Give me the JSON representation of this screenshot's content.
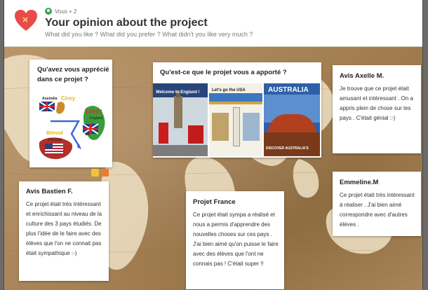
{
  "header": {
    "author": "Vous + 2",
    "title": "Your opinion about the project",
    "subtitle": "What did you like ? What did you prefer ? What didn't you like very much ?"
  },
  "cards": {
    "c1": {
      "title": "Qu'avez vous apprécié dans ce projet ?"
    },
    "c1_img": {
      "l1": "Australia",
      "l2": "Cirey",
      "l3": "Laxou",
      "l4": "England",
      "l5": "Blénod",
      "l6": "The USA"
    },
    "c2": {
      "title": "Qu'est-ce que le projet vous a apporté ?"
    },
    "c2_img": {
      "t1": "Welcome to England !",
      "t2": "Let's go the USA",
      "t3": "AUSTRALIA",
      "t4": "DISCOVER AUSTRALIA'S secrets"
    },
    "c3": {
      "title": "Avis Axelle M.",
      "body": "Je trouve que ce projet était amusant et intéressant . On a appris plein de chose sur les pays . C'était génial :-)"
    },
    "c4": {
      "title": "Avis Bastien F.",
      "body": "Ce projet était très intéressant et enrichissant au niveau de la culture des 3 pays étudiés. De plus l'idée de le faire avec des élèves que l'on ne connait pas était sympathique :-)"
    },
    "c5": {
      "title": "Projet France",
      "body": "Ce projet était sympa a réalisé et nous a permis d'apprendre des nouvelles choses sur ces pays . J'ai bien aimé qu'on puisse le faire avec des élèves que l'ont ne connais pas ! C'était super !!"
    },
    "c6": {
      "title": "Emmeline.M",
      "body": "Ce projet était très intéressant à réaliser . J'ai bien aimé correspondre avec d'autres élèves ."
    }
  },
  "icons": {
    "heart": "heart-icon",
    "author": "user-group-icon",
    "edit": "pencil-icon",
    "delete": "trash-icon"
  },
  "colors": {
    "heart": "#e94b4b",
    "board": "#a98458",
    "edit": "#f0c23a",
    "delete": "#ee7a32"
  }
}
